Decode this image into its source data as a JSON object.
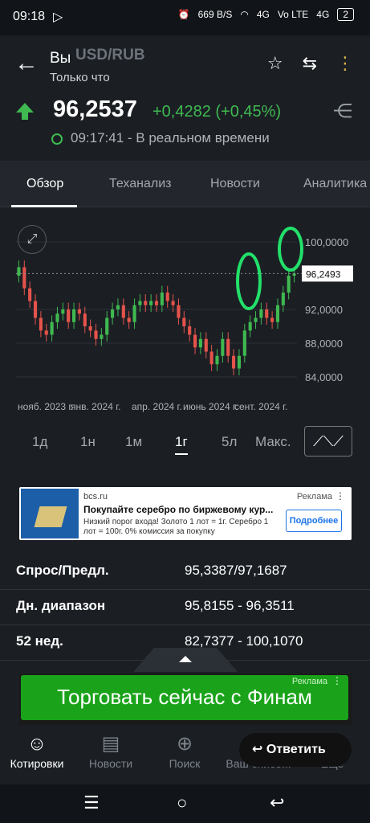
{
  "statusbar": {
    "time": "09:18",
    "speed": "669 B/S",
    "net1": "4G",
    "volte": "Vo LTE",
    "net2": "4G",
    "battery": "2"
  },
  "header": {
    "title": "Вы",
    "faded_title": "USD/RUB",
    "subtitle": "Только что"
  },
  "quote": {
    "price": "96,2537",
    "change": "+0,4282 (+0,45%)",
    "time": "09:17:41 - В реальном времени",
    "direction_color": "#3fb950"
  },
  "tabs": [
    {
      "label": "Обзор"
    },
    {
      "label": "Теханализ"
    },
    {
      "label": "Новости"
    },
    {
      "label": "Аналитика"
    }
  ],
  "chart_data": {
    "type": "candlestick",
    "x_labels": [
      "нояб. 2023 г.",
      "янв. 2024 г.",
      "апр. 2024 г.",
      "июнь 2024 г.",
      "сент. 2024 г."
    ],
    "y_ticks": [
      "100,0000",
      "92,0000",
      "88,0000",
      "84,0000"
    ],
    "current_label": "96,2493",
    "ylim": [
      82,
      102
    ],
    "grid": true,
    "up_color": "#3fb950",
    "down_color": "#e5534b",
    "closes": [
      97.0,
      94.5,
      93.0,
      91.0,
      89.5,
      89.0,
      90.5,
      91.5,
      92.0,
      90.5,
      92.0,
      91.5,
      90.0,
      89.5,
      88.5,
      89.0,
      91.0,
      92.0,
      92.5,
      91.0,
      90.5,
      92.5,
      93.0,
      92.5,
      93.0,
      92.5,
      94.0,
      93.0,
      92.5,
      91.0,
      90.0,
      89.0,
      87.5,
      88.5,
      87.0,
      85.5,
      86.5,
      88.5,
      86.5,
      85.0,
      86.5,
      89.5,
      90.5,
      91.0,
      92.0,
      91.0,
      90.5,
      92.5,
      94.0,
      96.0,
      96.25
    ]
  },
  "ranges": [
    "1д",
    "1н",
    "1м",
    "1г",
    "5л",
    "Макс."
  ],
  "active_range": "1г",
  "ad_top": {
    "site": "bcs.ru",
    "tag": "Реклама",
    "headline": "Покупайте серебро по биржевому кур...",
    "body": "Низкий порог входа! Золото 1 лот = 1г. Серебро 1 лот = 100г. 0% комиссия за покупку",
    "cta": "Подробнее"
  },
  "stats": [
    {
      "key": "Спрос/Предл.",
      "value": "95,3387/97,1687"
    },
    {
      "key": "Дн. диапазон",
      "value": "95,8155 - 96,3511"
    },
    {
      "key": "52 нед.",
      "value": "82,7377 - 100,1070"
    }
  ],
  "ad_bottom": {
    "text": "Торговать сейчас с Финам",
    "tag": "Реклама"
  },
  "bottom_nav": [
    {
      "label": "Котировки",
      "icon": "smiley-icon"
    },
    {
      "label": "Новости",
      "icon": "news-icon"
    },
    {
      "label": "Поиск",
      "icon": "globe-icon"
    },
    {
      "label": "Ваш списо...",
      "icon": "list-icon"
    },
    {
      "label": "Еще",
      "icon": "menu-icon"
    }
  ],
  "reply_label": "Ответить"
}
